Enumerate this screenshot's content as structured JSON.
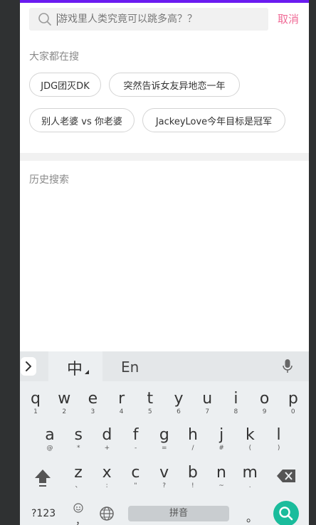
{
  "search": {
    "placeholder": "游戏里人类究竟可以跳多高？？",
    "value": "",
    "cancel_label": "取消"
  },
  "hot": {
    "title": "大家都在搜",
    "chips": [
      "JDG团灭DK",
      "突然告诉女友异地恋一年",
      "别人老婆 vs 你老婆",
      "JackeyLove今年目标是冠军"
    ]
  },
  "history": {
    "title": "历史搜索"
  },
  "keyboard": {
    "lang_zh": "中",
    "lang_en": "En",
    "row1": [
      {
        "k": "q",
        "s": "1"
      },
      {
        "k": "w",
        "s": "2"
      },
      {
        "k": "e",
        "s": "3"
      },
      {
        "k": "r",
        "s": "4"
      },
      {
        "k": "t",
        "s": "5"
      },
      {
        "k": "y",
        "s": "6"
      },
      {
        "k": "u",
        "s": "7"
      },
      {
        "k": "i",
        "s": "8"
      },
      {
        "k": "o",
        "s": "9"
      },
      {
        "k": "p",
        "s": "0"
      }
    ],
    "row2": [
      {
        "k": "a",
        "s": "@"
      },
      {
        "k": "s",
        "s": "*"
      },
      {
        "k": "d",
        "s": "+"
      },
      {
        "k": "f",
        "s": "-"
      },
      {
        "k": "g",
        "s": "="
      },
      {
        "k": "h",
        "s": "/"
      },
      {
        "k": "j",
        "s": "#"
      },
      {
        "k": "k",
        "s": "("
      },
      {
        "k": "l",
        "s": ")"
      }
    ],
    "row3": [
      {
        "k": "z",
        "s": "、"
      },
      {
        "k": "x",
        "s": ":"
      },
      {
        "k": "c",
        "s": "\""
      },
      {
        "k": "v",
        "s": "?"
      },
      {
        "k": "b",
        "s": "!"
      },
      {
        "k": "n",
        "s": "~"
      },
      {
        "k": "m",
        "s": "."
      }
    ],
    "key_123": "?123",
    "space_label": "拼音",
    "punct": "。",
    "emoji_comma": "，"
  },
  "colors": {
    "accent": "#6a1bf0",
    "cancel": "#f06a96",
    "search_button": "#1abc9c"
  }
}
